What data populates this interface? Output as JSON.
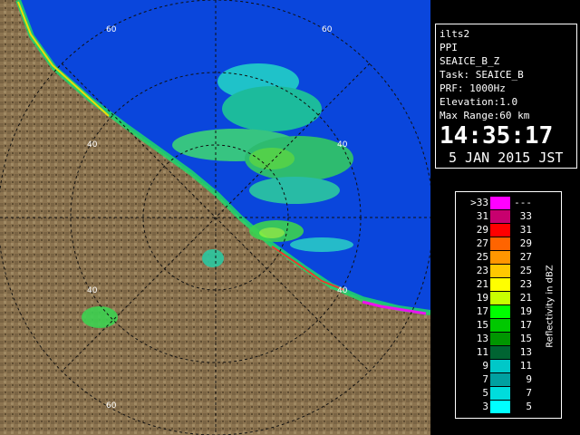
{
  "info": {
    "lines": [
      "ilts2",
      "PPI",
      "SEAICE_B_Z",
      "Task: SEAICE_B",
      "PRF: 1000Hz",
      "Elevation:1.0",
      "Max Range:60 km"
    ],
    "time": "14:35:17",
    "date": "5 JAN 2015 JST"
  },
  "range_rings": {
    "labels": [
      "60",
      "40",
      "40",
      "40",
      "40",
      "60",
      "60"
    ]
  },
  "legend": {
    "title": "Reflectivity in dBZ",
    "rows": [
      {
        "left": ">33",
        "right": "---",
        "color": "#ff00ff"
      },
      {
        "left": "31",
        "right": "33",
        "color": "#c8006e"
      },
      {
        "left": "29",
        "right": "31",
        "color": "#ff0000"
      },
      {
        "left": "27",
        "right": "29",
        "color": "#ff6400"
      },
      {
        "left": "25",
        "right": "27",
        "color": "#ff9600"
      },
      {
        "left": "23",
        "right": "25",
        "color": "#ffc800"
      },
      {
        "left": "21",
        "right": "23",
        "color": "#ffff00"
      },
      {
        "left": "19",
        "right": "21",
        "color": "#c8ff00"
      },
      {
        "left": "17",
        "right": "19",
        "color": "#00ff00"
      },
      {
        "left": "15",
        "right": "17",
        "color": "#00c800"
      },
      {
        "left": "13",
        "right": "15",
        "color": "#009600"
      },
      {
        "left": "11",
        "right": "13",
        "color": "#006432"
      },
      {
        "left": "9",
        "right": "11",
        "color": "#00c8c8"
      },
      {
        "left": "7",
        "right": "9",
        "color": "#00a0a0"
      },
      {
        "left": "5",
        "right": "7",
        "color": "#00dcdc"
      },
      {
        "left": "3",
        "right": "5",
        "color": "#00ffff"
      }
    ]
  },
  "colors": {
    "sea": "#0a46dc",
    "land": "#8c7450",
    "land_dark": "#6e5a3c",
    "ring": "#101010",
    "border": "#ffffff"
  }
}
